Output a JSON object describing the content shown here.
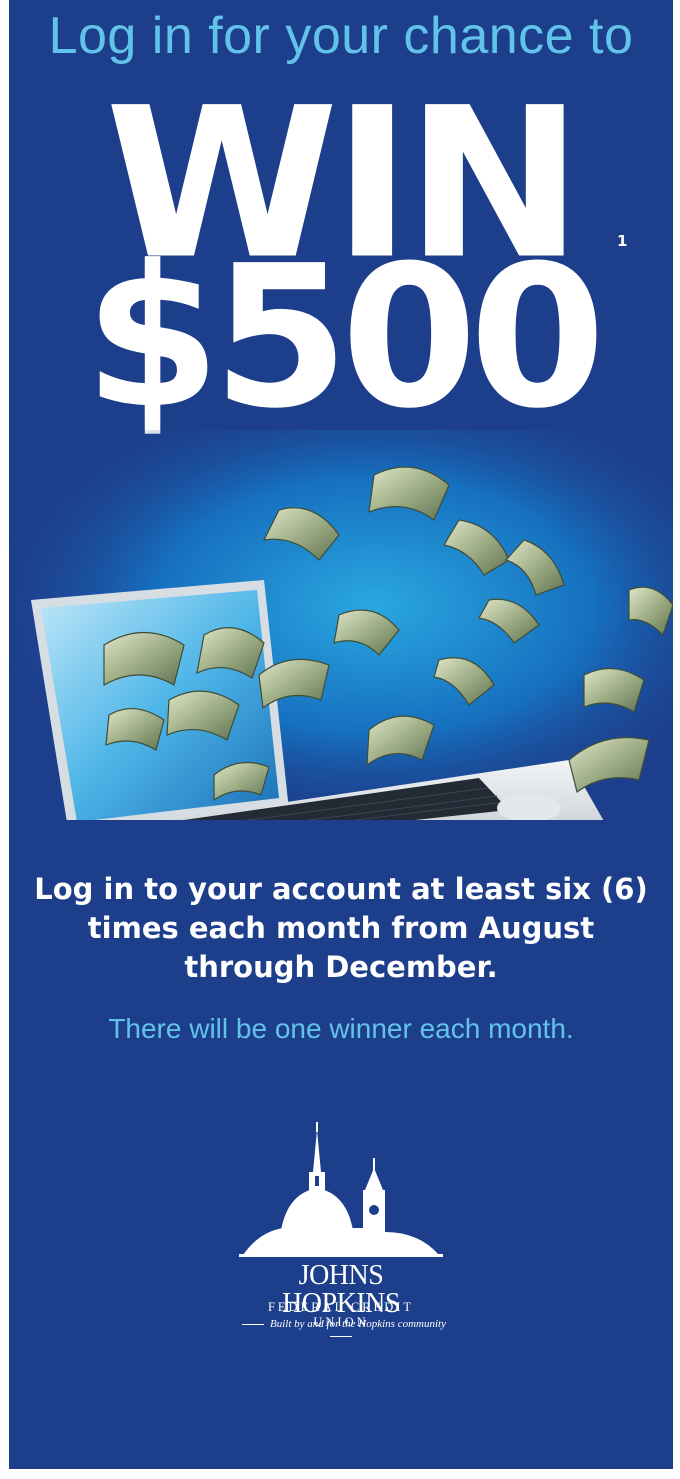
{
  "ad": {
    "headline": "Log in for your chance to",
    "win": "WIN",
    "amount": "$500",
    "footnote_marker": "1",
    "body": "Log in to your account at least six (6) times each month from August through December.",
    "subtext": "There will be one winner each month."
  },
  "logo": {
    "name": "JOHNS HOPKINS",
    "subname": "FEDERAL CREDIT UNION",
    "tagline": "Built by and for the Hopkins community"
  },
  "colors": {
    "background": "#1d3e8b",
    "accent": "#62c3ea",
    "text": "#ffffff"
  },
  "icons": [
    "laptop-illustration",
    "flying-dollar-bills",
    "hopkins-dome-logo"
  ]
}
